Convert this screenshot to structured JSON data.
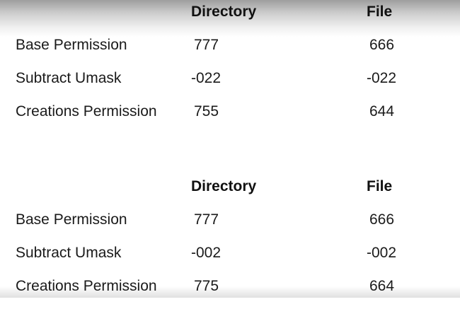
{
  "tables": [
    {
      "headers": {
        "directory": "Directory",
        "file": "File"
      },
      "rows": [
        {
          "label": "Base Permission",
          "directory": "777",
          "file": "666"
        },
        {
          "label": "Subtract Umask",
          "directory": "-022",
          "file": "-022"
        },
        {
          "label": "Creations Permission",
          "directory": "755",
          "file": "644"
        }
      ]
    },
    {
      "headers": {
        "directory": "Directory",
        "file": "File"
      },
      "rows": [
        {
          "label": "Base Permission",
          "directory": "777",
          "file": "666"
        },
        {
          "label": "Subtract Umask",
          "directory": "-002",
          "file": "-002"
        },
        {
          "label": "Creations Permission",
          "directory": "775",
          "file": "664"
        }
      ]
    }
  ]
}
